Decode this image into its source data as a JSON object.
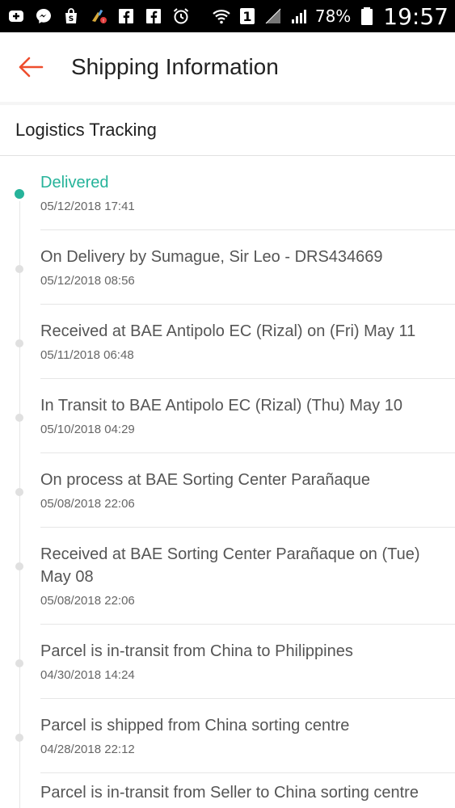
{
  "status_bar": {
    "battery": "78%",
    "time": "19:57",
    "sim_slot": "1"
  },
  "header": {
    "title": "Shipping Information"
  },
  "section": {
    "title": "Logistics Tracking"
  },
  "tracking": [
    {
      "status": "Delivered",
      "time": "05/12/2018 17:41",
      "active": true
    },
    {
      "status": "On Delivery by Sumague, Sir Leo - DRS434669",
      "time": "05/12/2018 08:56"
    },
    {
      "status": "Received at BAE Antipolo EC (Rizal) on (Fri) May 11",
      "time": "05/11/2018 06:48"
    },
    {
      "status": "In Transit to BAE Antipolo EC (Rizal) (Thu) May 10",
      "time": "05/10/2018 04:29"
    },
    {
      "status": "On process at BAE Sorting Center Parañaque",
      "time": "05/08/2018 22:06"
    },
    {
      "status": "Received at BAE Sorting Center Parañaque on (Tue) May 08",
      "time": "05/08/2018 22:06"
    },
    {
      "status": "Parcel is in-transit from China to Philippines",
      "time": "04/30/2018 14:24"
    },
    {
      "status": "Parcel is shipped from China sorting centre",
      "time": "04/28/2018 22:12"
    },
    {
      "status": "Parcel is in-transit from Seller to China sorting centre",
      "time": ""
    }
  ],
  "colors": {
    "accent": "#ee4d2d",
    "delivered": "#26b39a",
    "muted_dot": "#e0e0e0"
  }
}
